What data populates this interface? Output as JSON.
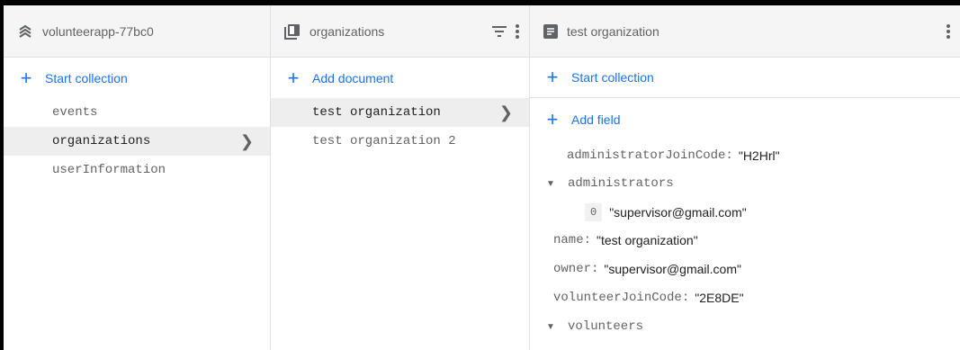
{
  "project": {
    "name": "volunteerapp-77bc0",
    "start_collection": "Start collection",
    "collections": [
      {
        "label": "events",
        "selected": false
      },
      {
        "label": "organizations",
        "selected": true
      },
      {
        "label": "userInformation",
        "selected": false
      }
    ]
  },
  "collection": {
    "name": "organizations",
    "add_document": "Add document",
    "documents": [
      {
        "label": "test organization",
        "selected": true
      },
      {
        "label": "test organization 2",
        "selected": false
      }
    ]
  },
  "document": {
    "name": "test organization",
    "start_collection": "Start collection",
    "add_field": "Add field",
    "fields": {
      "administratorJoinCode": {
        "key": "administratorJoinCode:",
        "value": "\"H2Hrl\""
      },
      "administrators": {
        "key": "administrators",
        "items": [
          {
            "index": "0",
            "value": "\"supervisor@gmail.com\""
          }
        ]
      },
      "name": {
        "key": "name:",
        "value": "\"test organization\""
      },
      "owner": {
        "key": "owner:",
        "value": "\"supervisor@gmail.com\""
      },
      "volunteerJoinCode": {
        "key": "volunteerJoinCode:",
        "value": "\"2E8DE\""
      },
      "volunteers": {
        "key": "volunteers"
      }
    }
  },
  "icons": {
    "project": "project-icon",
    "collection": "collection-icon",
    "document": "document-icon",
    "filter": "filter-icon",
    "more": "more-vert-icon"
  },
  "colors": {
    "accent": "#1a73e8",
    "header_bg": "#f5f5f5",
    "selected_bg": "#eeeeee"
  }
}
